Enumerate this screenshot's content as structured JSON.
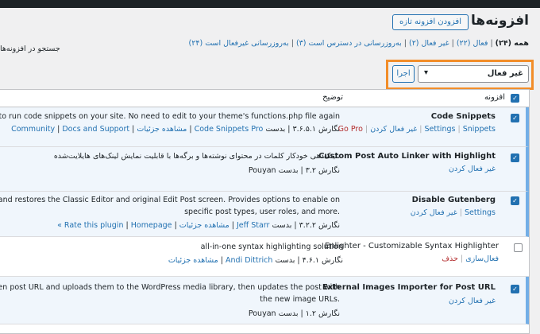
{
  "header": {
    "title": "افزونه‌ها",
    "add_new": "افزودن افزونه تازه"
  },
  "filters": {
    "all": "همه (۲۴)",
    "active": "فعال (۲۲)",
    "inactive": "غیر فعال (۲)",
    "auto_updates_on": "به‌روزرسانی در دسترس است (۳)",
    "auto_updates_off": "به‌روزرسانی غیرفعال است (۲۴)",
    "sep": "|"
  },
  "search": {
    "label": "جستجو در افزونه‌ها"
  },
  "bulk": {
    "selected": "غیر فعال",
    "apply": "اجرا"
  },
  "table": {
    "col_plugin": "افزونه",
    "col_desc": "توضیح"
  },
  "plugins": [
    {
      "name": "Code Snippets",
      "actions": [
        "Settings",
        "Snippets",
        "غیر فعال کردن",
        "Go Pro"
      ],
      "desc": "An easy, clean and simple way to run code snippets on your site. No need to edit to your theme's functions.php file again",
      "version": "نگارش ۳.۶.۵.۱",
      "by": "بدست",
      "author": "Code Snippets Pro",
      "links": [
        "مشاهده جزئیات",
        "Community",
        "Docs and Support"
      ]
    },
    {
      "name": "Custom Post Auto Linker with Highlight",
      "actions": [
        "غیر فعال کردن"
      ],
      "desc": "لینک‌دهی خودکار کلمات در محتوای نوشته‌ها و برگه‌ها با قابلیت نمایش لینک‌های هایلایت‌شده.",
      "version": "نگارش ۳.۲",
      "by": "بدست",
      "author": "Pouyan",
      "links": []
    },
    {
      "name": "Disable Gutenberg",
      "actions": [
        "Settings",
        "غیر فعال کردن"
      ],
      "desc_line1": "Disables Gutenberg Block Editor and restores the Classic Editor and original Edit Post screen. Provides options to enable on",
      "desc_line2": "specific post types, user roles, and more.",
      "version": "نگارش ۳.۲.۲",
      "by": "بدست",
      "author": "Jeff Starr",
      "links": [
        "مشاهده جزئیات",
        "Rate this plugin",
        "Homepage »"
      ]
    },
    {
      "name": "Enlighter - Customizable Syntax Highlighter",
      "actions": [
        "فعال‌سازی",
        "حذف"
      ],
      "desc": "all-in-one syntax highlighting solution",
      "version": "نگارش ۴.۶.۱",
      "by": "بدست",
      "author": "Andi Dittrich",
      "links": [
        "مشاهده جزئیات"
      ]
    },
    {
      "name": "External Images Importer for Post URL",
      "actions": [
        "غیر فعال کردن"
      ],
      "desc_line1": "Imports images from a given post URL and uploads them to the WordPress media library, then updates the post with",
      "desc_line2": "the new image URLs.",
      "version": "نگارش ۱.۲",
      "by": "بدست",
      "author": "Pouyan",
      "links": []
    }
  ],
  "colors": {
    "accent": "#2271b1",
    "highlight": "#f28d29",
    "active_row": "#f0f6fc"
  }
}
